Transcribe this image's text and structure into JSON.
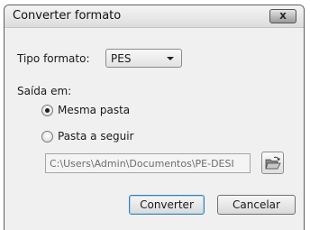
{
  "dialog": {
    "title": "Converter formato",
    "close_label": "x"
  },
  "format": {
    "label": "Tipo formato:",
    "selected": "PES"
  },
  "output": {
    "label": "Saída em:",
    "options": [
      {
        "label": "Mesma pasta",
        "checked": true
      },
      {
        "label": "Pasta a seguir",
        "checked": false
      }
    ],
    "path_value": "C:\\Users\\Admin\\Documentos\\PE-DESI"
  },
  "icons": {
    "close": "close-icon",
    "dropdown": "chevron-down-icon",
    "browse": "open-folder-icon"
  },
  "buttons": {
    "convert": "Converter",
    "cancel": "Cancelar"
  }
}
